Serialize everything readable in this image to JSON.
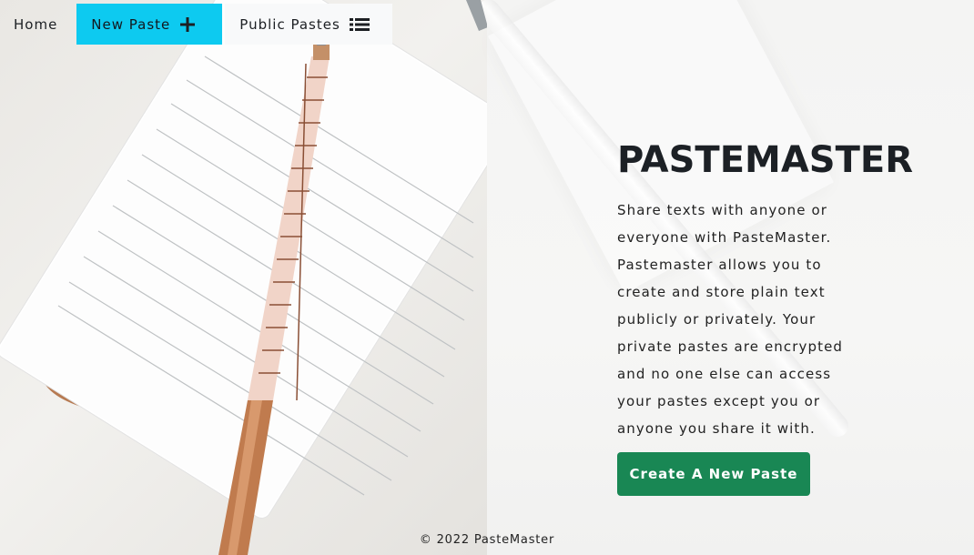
{
  "nav": {
    "home_label": "Home",
    "new_paste_label": "New Paste",
    "public_pastes_label": "Public Pastes"
  },
  "hero": {
    "title": "PASTEMASTER",
    "description": "Share texts with anyone or everyone with PasteMaster. Pastemaster allows you to create and store plain text publicly or privately. Your private pastes are encrypted and no one else can access your pastes except you or anyone you share it with.",
    "cta_label": "Create A New Paste"
  },
  "footer": {
    "copyright": "© 2022 PasteMaster"
  },
  "colors": {
    "new_paste_bg": "#0dcaf0",
    "public_pastes_bg": "#f8f9fa",
    "cta_bg": "#198754"
  },
  "icons": {
    "new_paste": "plus-icon",
    "public_pastes": "list-icon"
  }
}
